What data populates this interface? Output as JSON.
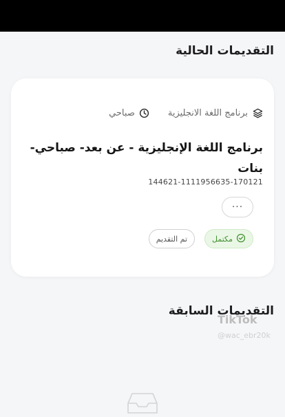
{
  "colors": {
    "background": "#f5f6f8",
    "card": "#ffffff",
    "complete_green": "#3f8f2f",
    "complete_bg": "#eaf7e6",
    "text_dark": "#151515",
    "text_muted": "#6b6b6b"
  },
  "current": {
    "title": "التقديمات الحالية",
    "application": {
      "program_type": "برنامج اللغة الانجليزية",
      "program_type_icon": "layers-icon",
      "period": "صباحي",
      "period_icon": "clock-icon",
      "name": "برنامج اللغة الإنجليزية - عن بعد- صباحي- بنات",
      "number": "144621-1111956635-170121",
      "more_label": "···",
      "status_label": "مكتمل",
      "status_icon": "check-circle-icon",
      "submitted_label": "تم التقديم"
    }
  },
  "previous": {
    "title": "التقديمات السابقة",
    "empty_icon": "inbox-icon"
  },
  "watermark": {
    "logo": "TikTok",
    "handle": "@wac_ebr20k"
  }
}
